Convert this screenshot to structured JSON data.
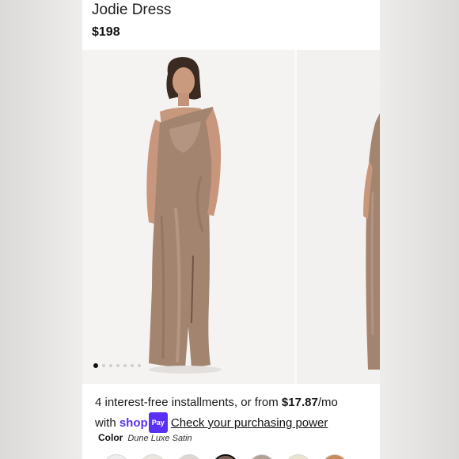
{
  "product": {
    "title": "Jodie Dress",
    "price": "$198"
  },
  "gallery": {
    "image_count": 7,
    "active_index": 0
  },
  "installments": {
    "text_prefix": "4 interest-free installments, or from ",
    "amount": "$17.87",
    "text_suffix": "/mo",
    "with_text": "with ",
    "shop_word": "shop",
    "pay_word": "Pay",
    "link_text": "Check your purchasing power"
  },
  "color": {
    "label": "Color",
    "value": "Dune Luxe Satin"
  },
  "swatches": [
    {
      "color": "#eeeeee",
      "selected": false
    },
    {
      "color": "#e9e6df",
      "selected": false
    },
    {
      "color": "#dcd7d2",
      "selected": false
    },
    {
      "color": "#7a6256",
      "selected": true
    },
    {
      "color": "#b0a197",
      "selected": false
    },
    {
      "color": "#e7e4cf",
      "selected": false
    },
    {
      "color": "#c88a5a",
      "selected": false
    }
  ],
  "colors": {
    "accent_shop": "#5a31f4",
    "dress": "#a08272"
  }
}
